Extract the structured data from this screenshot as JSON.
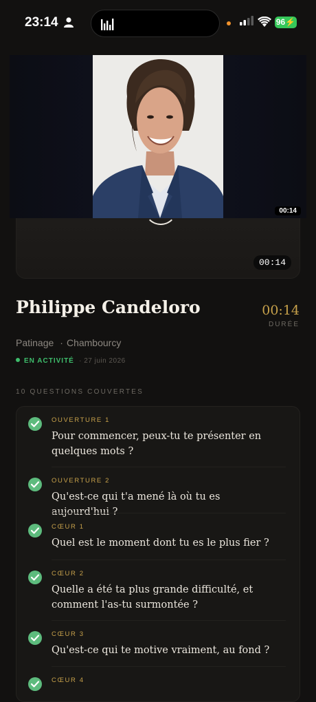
{
  "status_bar": {
    "time": "23:14",
    "battery": "96"
  },
  "video": {
    "timestamp": "00:14",
    "player_timestamp": "00:14"
  },
  "profile": {
    "name": "Philippe Candeloro",
    "duration": "00:14",
    "duration_label": "DURÉE",
    "category": "Patinage",
    "location": "Chambourcy",
    "status": "EN ACTIVITÉ",
    "date": "27 juin 2026"
  },
  "questions": {
    "count_label": "10 QUESTIONS COUVERTES",
    "items": [
      {
        "tag": "OUVERTURE 1",
        "text": "Pour commencer, peux-tu te présenter en quelques mots ?"
      },
      {
        "tag": "OUVERTURE 2",
        "text": "Qu'est-ce qui t'a mené là où tu es aujourd'hui ?"
      },
      {
        "tag": "CŒUR 1",
        "text": "Quel est le moment dont tu es le plus fier ?"
      },
      {
        "tag": "CŒUR 2",
        "text": "Quelle a été ta plus grande difficulté, et comment l'as-tu surmontée ?"
      },
      {
        "tag": "CŒUR 3",
        "text": "Qu'est-ce qui te motive vraiment, au fond ?"
      },
      {
        "tag": "CŒUR 4",
        "text": ""
      }
    ]
  },
  "colors": {
    "accent_gold": "#c8a24b",
    "success_green": "#5dbb7d",
    "background": "#121110"
  }
}
